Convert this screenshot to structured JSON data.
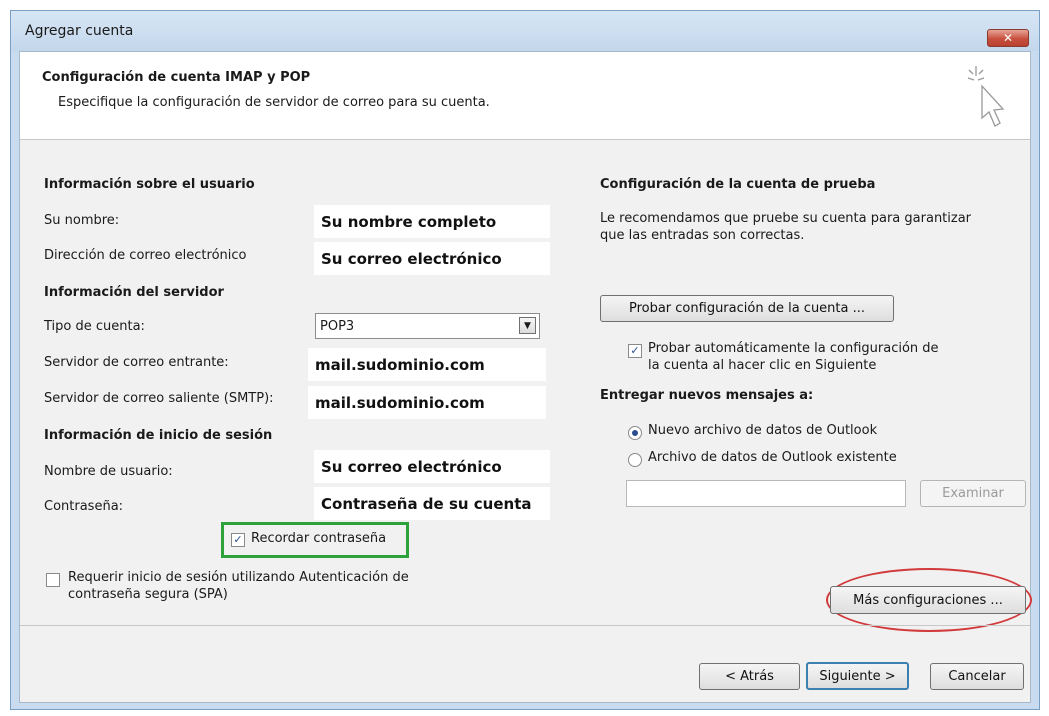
{
  "window": {
    "title": "Agregar cuenta",
    "close_glyph": "✕"
  },
  "header": {
    "title": "Configuración de cuenta IMAP y POP",
    "subtitle": "Especifique la configuración de servidor de correo para su cuenta."
  },
  "user_info": {
    "heading": "Información sobre el usuario",
    "name_label": "Su nombre:",
    "name_value": "Su nombre completo",
    "email_label": "Dirección de correo electrónico",
    "email_value": "Su correo electrónico"
  },
  "server_info": {
    "heading": "Información del servidor",
    "account_type_label": "Tipo de cuenta:",
    "account_type_value": "POP3",
    "incoming_label": "Servidor de correo entrante:",
    "incoming_value": "mail.sudominio.com",
    "outgoing_label": "Servidor de correo saliente (SMTP):",
    "outgoing_value": "mail.sudominio.com"
  },
  "login_info": {
    "heading": "Información de inicio de sesión",
    "username_label": "Nombre de usuario:",
    "username_value": "Su correo electrónico",
    "password_label": "Contraseña:",
    "password_value": "Contraseña de su cuenta",
    "remember_label": "Recordar contraseña",
    "remember_checked": true,
    "spa_label_line1": "Requerir inicio de sesión utilizando Autenticación de",
    "spa_label_line2": "contraseña segura (SPA)",
    "spa_checked": false
  },
  "test_settings": {
    "heading": "Configuración de la cuenta de prueba",
    "desc_line1": "Le recomendamos que pruebe su cuenta para garantizar",
    "desc_line2": "que las entradas son correctas.",
    "test_button": "Probar configuración de la cuenta ...",
    "auto_test_line1": "Probar automáticamente la configuración de",
    "auto_test_line2": "la cuenta al hacer clic en Siguiente",
    "auto_test_checked": true
  },
  "deliver": {
    "heading": "Entregar nuevos mensajes a:",
    "option_new": "Nuevo archivo de datos de Outlook",
    "option_existing": "Archivo de datos de Outlook existente",
    "selected": "new",
    "browse_button": "Examinar"
  },
  "more_settings_button": "Más configuraciones ...",
  "footer": {
    "back_button": "< Atrás",
    "next_button": "Siguiente >",
    "cancel_button": "Cancelar"
  },
  "colors": {
    "highlight_green": "#2ea23a",
    "annotation_red": "#d23b3b",
    "close_red": "#c8503e"
  }
}
